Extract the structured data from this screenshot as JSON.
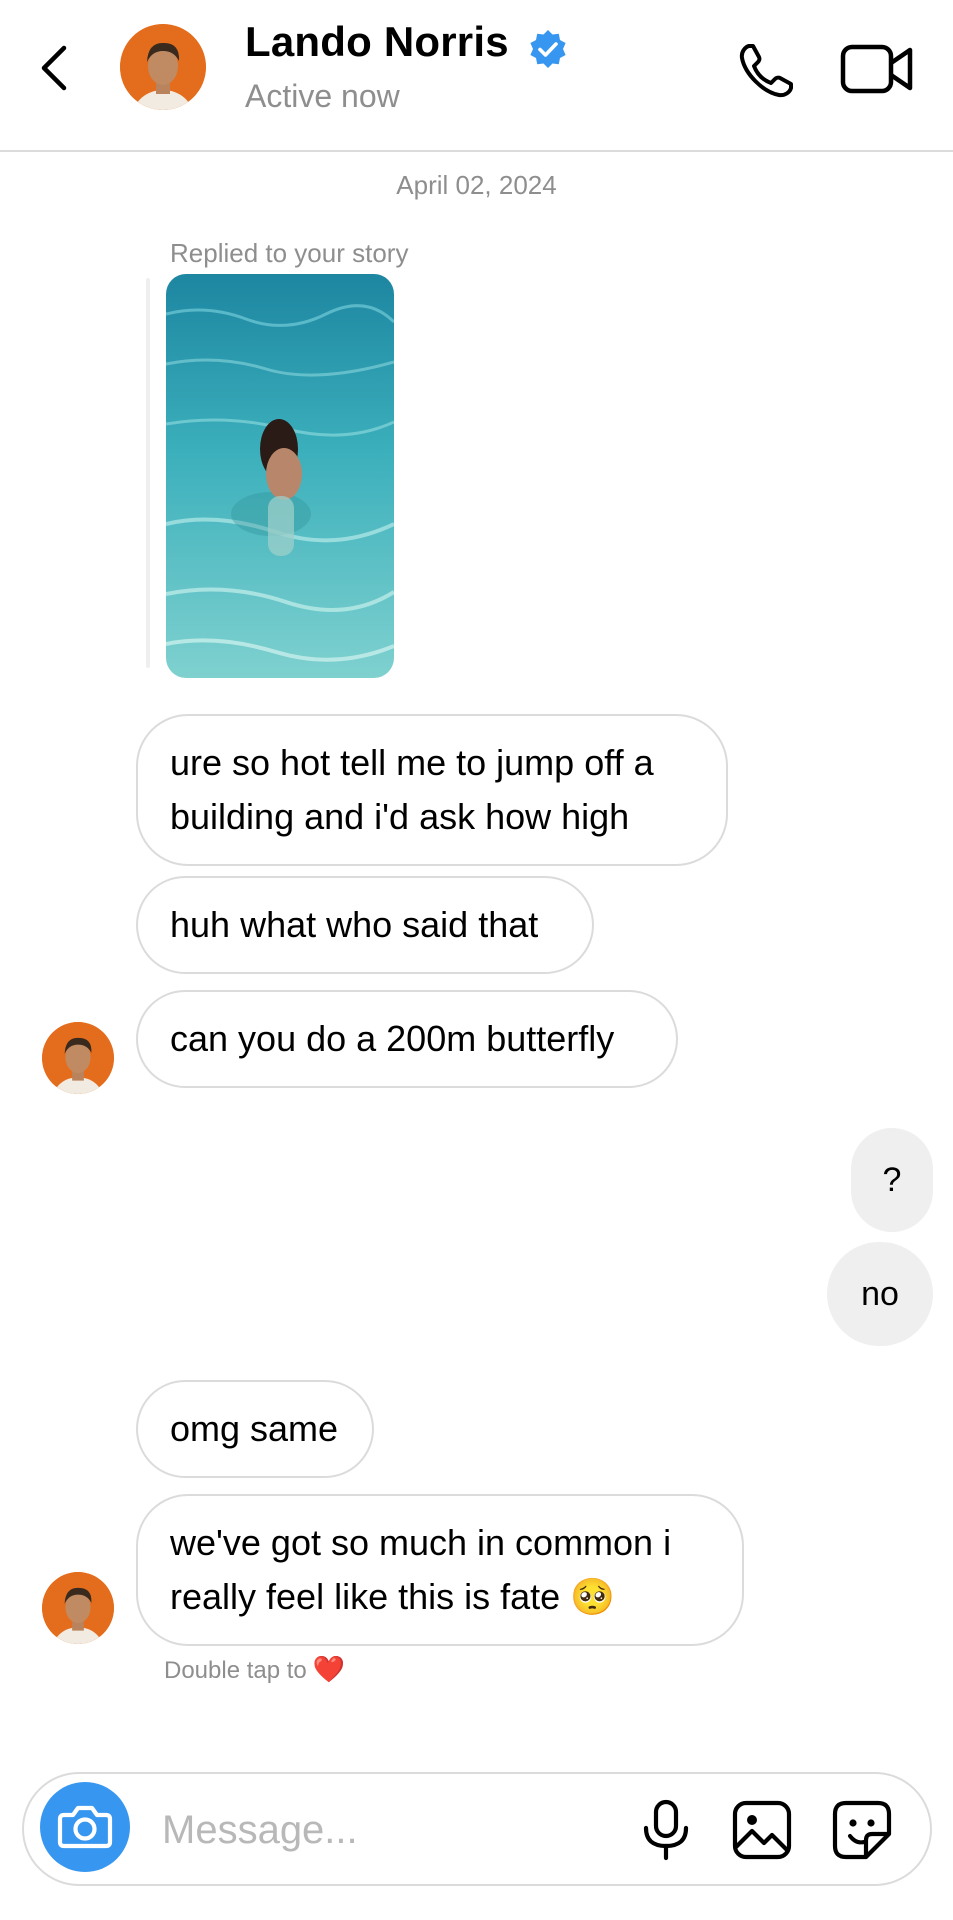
{
  "header": {
    "name": "Lando Norris",
    "status": "Active now",
    "verified_color": "#3797f0",
    "icons": [
      "back-icon",
      "verified-badge-icon",
      "phone-icon",
      "video-camera-icon"
    ]
  },
  "thread": {
    "date": "April 02, 2024",
    "story_reply_label": "Replied to your story",
    "messages": [
      {
        "from": "them",
        "text": "ure so hot tell me to jump off a\nbuilding and i'd ask how high"
      },
      {
        "from": "them",
        "text": "huh what who said that"
      },
      {
        "from": "them",
        "text": "can you do a 200m butterfly"
      },
      {
        "from": "me",
        "text": "?"
      },
      {
        "from": "me",
        "text": "no"
      },
      {
        "from": "them",
        "text": "omg same"
      },
      {
        "from": "them",
        "text": "we've got so much in common i\nreally feel like this is fate 🥺"
      }
    ],
    "double_tap_hint": "Double tap to",
    "double_tap_emoji": "❤️"
  },
  "composer": {
    "placeholder": "Message...",
    "accent": "#3797f0",
    "icons": [
      "camera-icon",
      "microphone-icon",
      "gallery-icon",
      "sticker-icon"
    ]
  }
}
